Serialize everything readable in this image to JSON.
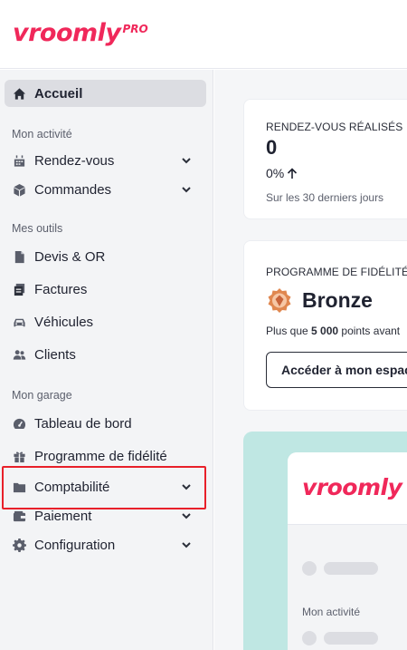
{
  "app": {
    "logo_text": "vroomly",
    "logo_badge": "PRO",
    "brand_color": "#f0285a"
  },
  "sidebar": {
    "home": {
      "label": "Accueil",
      "icon": "home-icon"
    },
    "sections": [
      {
        "title": "Mon activité",
        "items": [
          {
            "label": "Rendez-vous",
            "icon": "calendar-icon",
            "expandable": true
          },
          {
            "label": "Commandes",
            "icon": "cube-icon",
            "expandable": true
          }
        ]
      },
      {
        "title": "Mes outils",
        "items": [
          {
            "label": "Devis & OR",
            "icon": "document-icon",
            "expandable": false
          },
          {
            "label": "Factures",
            "icon": "invoice-icon",
            "expandable": false
          },
          {
            "label": "Véhicules",
            "icon": "car-icon",
            "expandable": false
          },
          {
            "label": "Clients",
            "icon": "users-icon",
            "expandable": false
          }
        ]
      },
      {
        "title": "Mon garage",
        "items": [
          {
            "label": "Tableau de bord",
            "icon": "gauge-icon",
            "expandable": false
          },
          {
            "label": "Programme de fidélité",
            "icon": "gift-icon",
            "expandable": false
          },
          {
            "label": "Comptabilité",
            "icon": "folder-icon",
            "expandable": true,
            "highlighted": true
          },
          {
            "label": "Paiement",
            "icon": "wallet-icon",
            "expandable": true
          },
          {
            "label": "Configuration",
            "icon": "gear-icon",
            "expandable": true
          }
        ]
      }
    ]
  },
  "main": {
    "appointments_card": {
      "title": "RENDEZ-VOUS RÉALISÉS",
      "value": "0",
      "change": "0%",
      "period": "Sur les 30 derniers jours"
    },
    "loyalty_card": {
      "title": "PROGRAMME DE FIDÉLITÉ",
      "tier": "Bronze",
      "points_prefix": "Plus que ",
      "points_value": "5 000",
      "points_suffix": " points avant",
      "button_label": "Accéder à mon espace"
    },
    "promo": {
      "logo_text": "vroomly",
      "section_label": "Mon activité",
      "background_color": "#bfe7e3"
    }
  }
}
